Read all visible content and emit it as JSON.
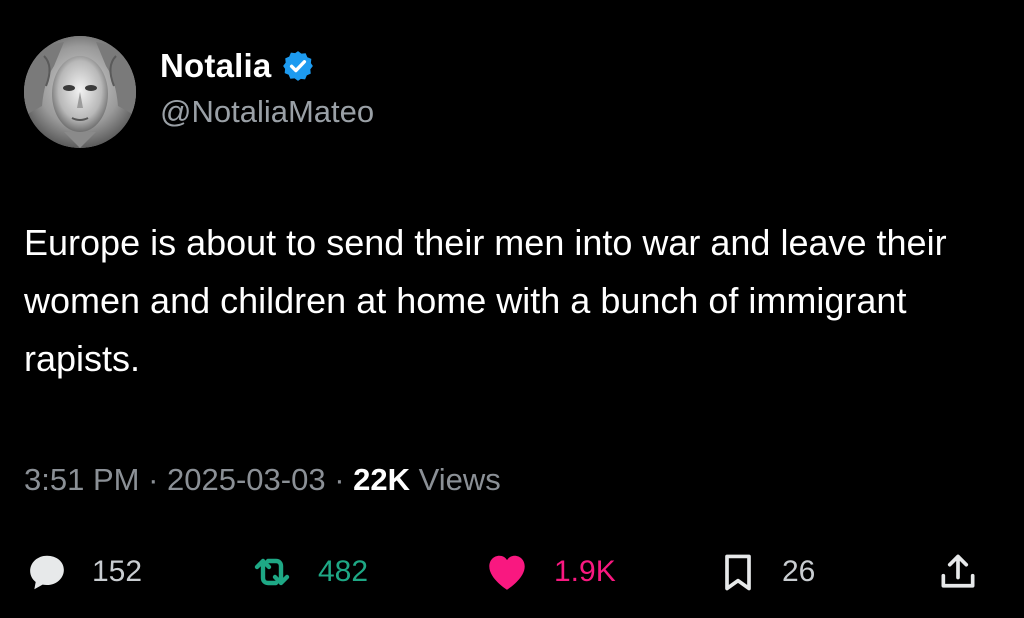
{
  "author": {
    "display_name": "Notalia",
    "handle": "@NotaliaMateo",
    "verified_icon": "verified-badge-icon"
  },
  "tweet": {
    "text": "Europe is about to send their men into war and leave their women and children at home with a bunch of immigrant rapists."
  },
  "meta": {
    "time": "3:51 PM",
    "separator": " · ",
    "date": "2025-03-03",
    "views_count": "22K",
    "views_label": "Views"
  },
  "actions": {
    "reply": {
      "icon": "reply-icon",
      "count": "152"
    },
    "retweet": {
      "icon": "retweet-icon",
      "count": "482"
    },
    "like": {
      "icon": "heart-icon",
      "count": "1.9K"
    },
    "bookmark": {
      "icon": "bookmark-icon",
      "count": "26"
    },
    "share": {
      "icon": "share-icon"
    }
  },
  "colors": {
    "background": "#000000",
    "verified_blue": "#1d9bf0",
    "retweet_green": "#1ea885",
    "like_pink": "#f91880",
    "muted_text": "#8b9096"
  }
}
